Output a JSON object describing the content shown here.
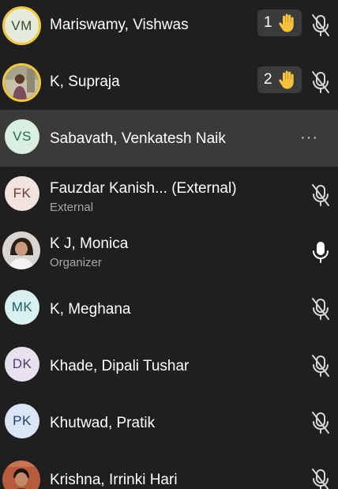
{
  "participants": [
    {
      "initials": "VM",
      "name": "Mariswamy, Vishwas",
      "sub": "",
      "hand": "1",
      "mic": "muted",
      "avatar_bg": "#e6eadc",
      "avatar_fg": "#3a4a2a",
      "raised": true
    },
    {
      "initials": "",
      "name": "K, Supraja",
      "sub": "",
      "hand": "2",
      "mic": "muted",
      "photo": true,
      "raised": true
    },
    {
      "initials": "VS",
      "name": "Sabavath, Venkatesh Naik",
      "sub": "",
      "hand": "",
      "mic": "more",
      "avatar_bg": "#d9efe2",
      "avatar_fg": "#1f6b4a",
      "hovered": true
    },
    {
      "initials": "FK",
      "name": "Fauzdar Kanish... (External)",
      "sub": "External",
      "hand": "",
      "mic": "muted",
      "avatar_bg": "#f2e3de",
      "avatar_fg": "#6a3e35"
    },
    {
      "initials": "",
      "name": "K J, Monica",
      "sub": "Organizer",
      "hand": "",
      "mic": "on",
      "photo": true
    },
    {
      "initials": "MK",
      "name": "K, Meghana",
      "sub": "",
      "hand": "",
      "mic": "muted",
      "avatar_bg": "#d8f0ef",
      "avatar_fg": "#1e5f63"
    },
    {
      "initials": "DK",
      "name": "Khade, Dipali Tushar",
      "sub": "",
      "hand": "",
      "mic": "muted",
      "avatar_bg": "#e8e2f0",
      "avatar_fg": "#4b3d6a"
    },
    {
      "initials": "PK",
      "name": "Khutwad, Pratik",
      "sub": "",
      "hand": "",
      "mic": "muted",
      "avatar_bg": "#dae6f5",
      "avatar_fg": "#1f3f6e"
    },
    {
      "initials": "",
      "name": "Krishna, Irrinki Hari",
      "sub": "",
      "hand": "",
      "mic": "muted",
      "photo": true
    }
  ],
  "more_label": "···",
  "colors": {
    "background": "#1f1f1f",
    "hover": "#3a3a3a",
    "raise_ring": "#f0c93a",
    "hand": "#f5c23a",
    "muted_icon": "#d6d6d6"
  }
}
